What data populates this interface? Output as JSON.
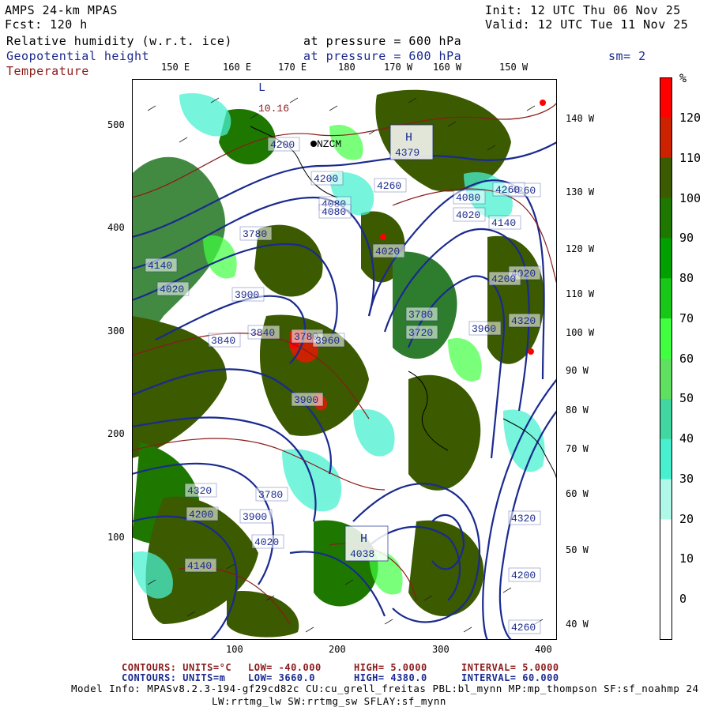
{
  "header": {
    "model": "AMPS 24-km MPAS",
    "forecast": "Fcst:  120 h",
    "init": "Init: 12 UTC Thu 06 Nov 25",
    "valid": "Valid: 12 UTC Tue 11 Nov 25",
    "smoothing": "sm= 2"
  },
  "fields": [
    {
      "name": "Relative humidity (w.r.t. ice)",
      "level": "at pressure =  600 hPa",
      "color": "#000000"
    },
    {
      "name": "Geopotential height",
      "level": "at pressure =  600 hPa",
      "color": "#1a2a8f"
    },
    {
      "name": "Temperature",
      "level": "at pressure =  600 hPa",
      "color": "#8b1a1a"
    }
  ],
  "top_lon_labels": [
    "150 E",
    "160 E",
    "170 E",
    "180",
    "170 W",
    "160 W",
    "150 W"
  ],
  "right_lon_labels": [
    "140 W",
    "130 W",
    "120 W",
    "110 W",
    "100 W",
    "90 W",
    "80 W",
    "70 W",
    "60 W",
    "50 W",
    "40 W"
  ],
  "y_ticks": [
    "500",
    "400",
    "300",
    "200",
    "100"
  ],
  "x_ticks": [
    "100",
    "200",
    "300",
    "400"
  ],
  "colorbar": {
    "unit": "%",
    "labels": [
      "120",
      "110",
      "100",
      "90",
      "80",
      "70",
      "60",
      "50",
      "40",
      "30",
      "20",
      "10",
      "0"
    ],
    "colors": [
      "#ff0000",
      "#cc2200",
      "#3c5a00",
      "#1e7800",
      "#00a000",
      "#18c818",
      "#40ff40",
      "#60e060",
      "#40d8a0",
      "#48f0d0",
      "#b0f8e8",
      "#ffffff",
      "#ffffff",
      "#ffffff"
    ]
  },
  "map_labels": {
    "highs": [
      {
        "text": "H",
        "value": "4379"
      },
      {
        "text": "H",
        "value": "4038"
      }
    ],
    "lows": [
      {
        "text": "L",
        "value": "10.16"
      }
    ],
    "place": "NZCM",
    "height_values": [
      "4200",
      "4200",
      "4080",
      "4260",
      "4020",
      "4080",
      "4140",
      "4020",
      "3780",
      "3900",
      "3780",
      "3960",
      "3840",
      "3840",
      "3900",
      "3720",
      "3960",
      "4020",
      "4080",
      "3780",
      "4260",
      "4140",
      "4020",
      "4320",
      "4200",
      "4260",
      "4320",
      "4200",
      "4140",
      "4020",
      "3900",
      "3780",
      "4320",
      "4200",
      "4260"
    ]
  },
  "footer": {
    "contour1": {
      "label": "CONTOURS:  UNITS=°C",
      "low": "LOW= -40.000",
      "high": "HIGH=  5.0000",
      "interval": "INTERVAL=  5.0000"
    },
    "contour2": {
      "label": "CONTOURS:  UNITS=m",
      "low": "LOW=  3660.0",
      "high": "HIGH=  4380.0",
      "interval": "INTERVAL=  60.000"
    },
    "model_info_1": "Model Info: MPASv8.2.3-194-gf29cd82c CU:cu_grell_freitas PBL:bl_mynn MP:mp_thompson SF:sf_noahmp 24",
    "model_info_2": "LW:rrtmg_lw SW:rrtmg_sw SFLAY:sf_mynn"
  }
}
